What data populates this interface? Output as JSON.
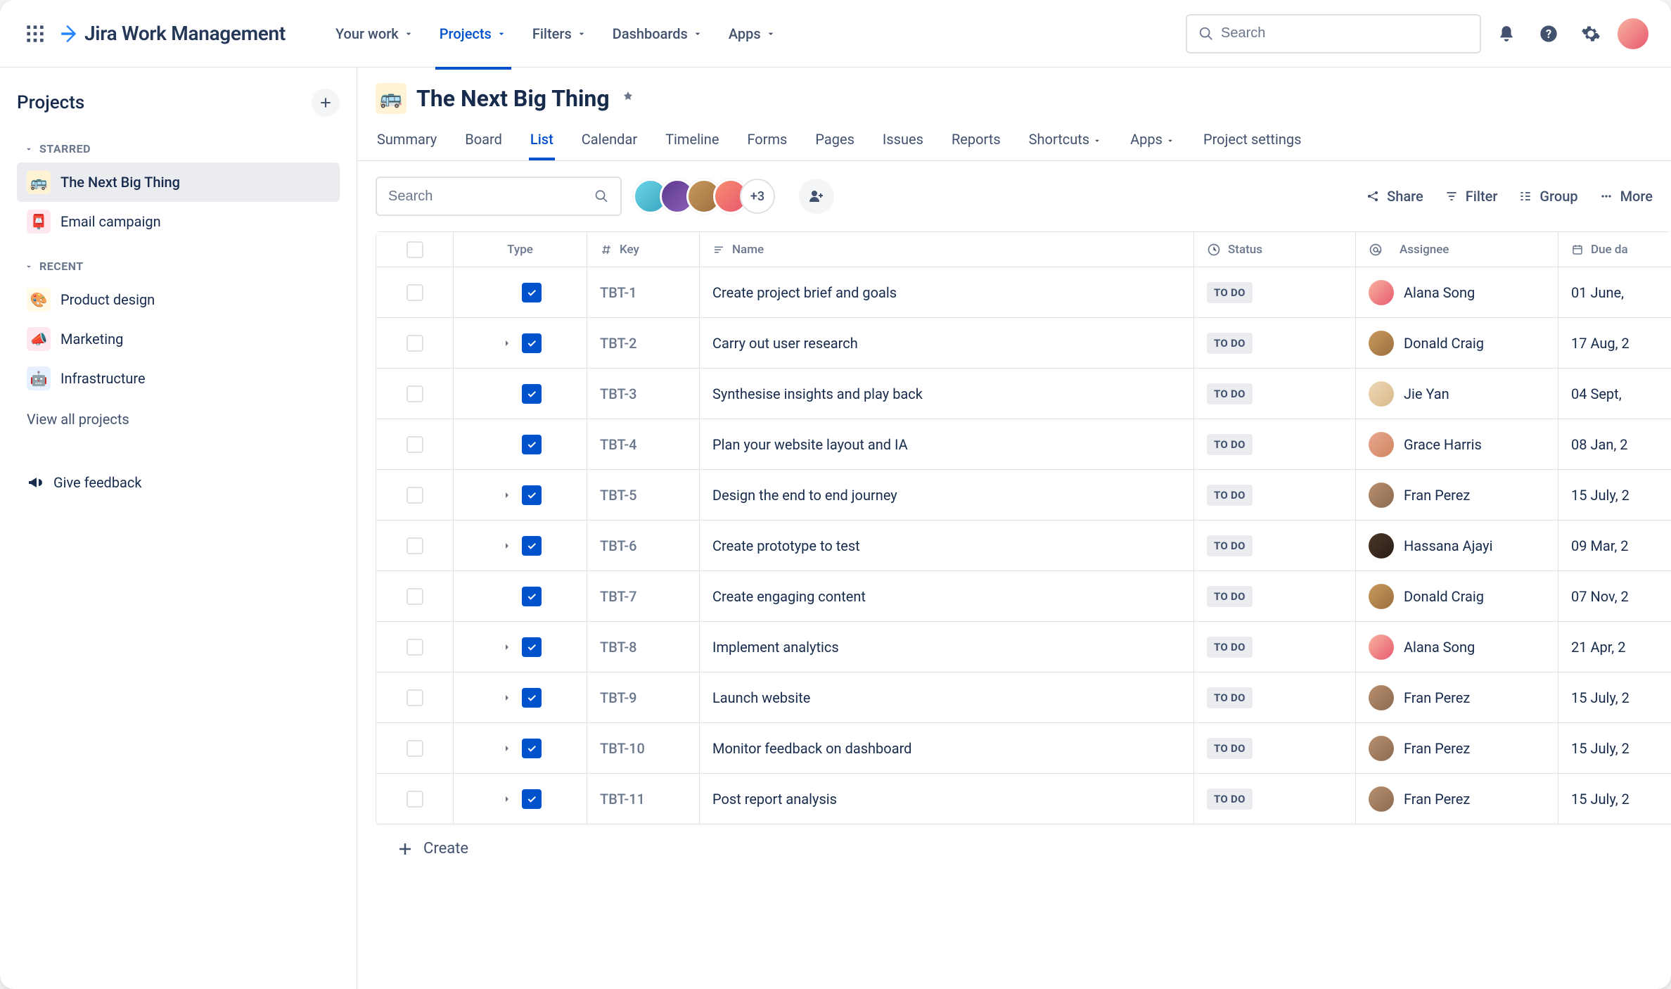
{
  "app": {
    "name": "Jira Work Management",
    "search_placeholder": "Search"
  },
  "topnav": {
    "items": [
      {
        "label": "Your work",
        "active": false,
        "dropdown": true
      },
      {
        "label": "Projects",
        "active": true,
        "dropdown": true
      },
      {
        "label": "Filters",
        "active": false,
        "dropdown": true
      },
      {
        "label": "Dashboards",
        "active": false,
        "dropdown": true
      },
      {
        "label": "Apps",
        "active": false,
        "dropdown": true
      }
    ]
  },
  "sidebar": {
    "title": "Projects",
    "sections": {
      "starred_label": "STARRED",
      "recent_label": "RECENT"
    },
    "starred": [
      {
        "label": "The Next Big Thing",
        "icon": "🚌",
        "iconClass": "i-bus",
        "active": true
      },
      {
        "label": "Email campaign",
        "icon": "📮",
        "iconClass": "i-mail",
        "active": false
      }
    ],
    "recent": [
      {
        "label": "Product design",
        "icon": "🎨",
        "iconClass": "i-design"
      },
      {
        "label": "Marketing",
        "icon": "📣",
        "iconClass": "i-mkt"
      },
      {
        "label": "Infrastructure",
        "icon": "🤖",
        "iconClass": "i-infra"
      }
    ],
    "view_all": "View all projects",
    "feedback": "Give feedback"
  },
  "project": {
    "icon": "🚌",
    "title": "The Next Big Thing",
    "tabs": [
      {
        "label": "Summary"
      },
      {
        "label": "Board"
      },
      {
        "label": "List",
        "active": true
      },
      {
        "label": "Calendar"
      },
      {
        "label": "Timeline"
      },
      {
        "label": "Forms"
      },
      {
        "label": "Pages"
      },
      {
        "label": "Issues"
      },
      {
        "label": "Reports"
      },
      {
        "label": "Shortcuts",
        "dropdown": true
      },
      {
        "label": "Apps",
        "dropdown": true
      },
      {
        "label": "Project settings"
      }
    ]
  },
  "toolbar": {
    "search_placeholder": "Search",
    "avatar_more": "+3",
    "actions": {
      "share": "Share",
      "filter": "Filter",
      "group": "Group",
      "more": "More"
    }
  },
  "table": {
    "columns": {
      "type": "Type",
      "key": "Key",
      "name": "Name",
      "status": "Status",
      "assignee": "Assignee",
      "due": "Due da"
    },
    "rows": [
      {
        "key": "TBT-1",
        "name": "Create project brief and goals",
        "status": "TO DO",
        "assignee": "Alana Song",
        "avClass": "aa1",
        "due": "01 June,",
        "expandable": false
      },
      {
        "key": "TBT-2",
        "name": "Carry out user research",
        "status": "TO DO",
        "assignee": "Donald Craig",
        "avClass": "aa2",
        "due": "17 Aug, 2",
        "expandable": true
      },
      {
        "key": "TBT-3",
        "name": "Synthesise insights and play back",
        "status": "TO DO",
        "assignee": "Jie Yan",
        "avClass": "aa3",
        "due": "04 Sept,",
        "expandable": false
      },
      {
        "key": "TBT-4",
        "name": "Plan your website layout and IA",
        "status": "TO DO",
        "assignee": "Grace Harris",
        "avClass": "aa4",
        "due": "08 Jan, 2",
        "expandable": false
      },
      {
        "key": "TBT-5",
        "name": "Design the end to end journey",
        "status": "TO DO",
        "assignee": "Fran Perez",
        "avClass": "aa5",
        "due": "15 July, 2",
        "expandable": true
      },
      {
        "key": "TBT-6",
        "name": "Create prototype to test",
        "status": "TO DO",
        "assignee": "Hassana Ajayi",
        "avClass": "aa6",
        "due": "09 Mar, 2",
        "expandable": true
      },
      {
        "key": "TBT-7",
        "name": "Create engaging content",
        "status": "TO DO",
        "assignee": "Donald Craig",
        "avClass": "aa2",
        "due": "07 Nov, 2",
        "expandable": false
      },
      {
        "key": "TBT-8",
        "name": "Implement analytics",
        "status": "TO DO",
        "assignee": "Alana Song",
        "avClass": "aa1",
        "due": "21 Apr, 2",
        "expandable": true
      },
      {
        "key": "TBT-9",
        "name": "Launch website",
        "status": "TO DO",
        "assignee": "Fran Perez",
        "avClass": "aa5",
        "due": "15 July, 2",
        "expandable": true
      },
      {
        "key": "TBT-10",
        "name": "Monitor feedback on dashboard",
        "status": "TO DO",
        "assignee": "Fran Perez",
        "avClass": "aa5",
        "due": "15 July, 2",
        "expandable": true
      },
      {
        "key": "TBT-11",
        "name": "Post report analysis",
        "status": "TO DO",
        "assignee": "Fran Perez",
        "avClass": "aa5",
        "due": "15 July, 2",
        "expandable": true
      }
    ],
    "create": "Create"
  }
}
